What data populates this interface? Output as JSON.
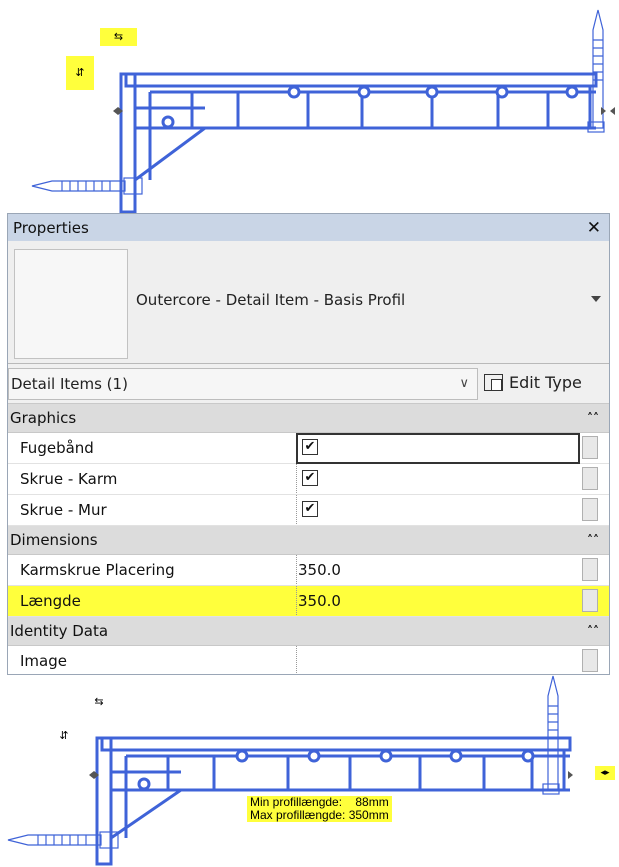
{
  "top_view": {
    "flip_h_icon": "⇆",
    "flip_v_icon": "⇵"
  },
  "properties": {
    "title": "Properties",
    "close_icon": "✕",
    "type_name": "Outercore - Detail Item - Basis Profil",
    "selector_label": "Detail Items (1)",
    "edit_type_label": "Edit Type",
    "groups": [
      {
        "label": "Graphics"
      },
      {
        "label": "Dimensions"
      },
      {
        "label": "Identity Data"
      }
    ],
    "graphics_rows": [
      {
        "name": "Fugebånd",
        "checked": true
      },
      {
        "name": "Skrue - Karm",
        "checked": true
      },
      {
        "name": "Skrue - Mur",
        "checked": true
      }
    ],
    "dimension_rows": [
      {
        "name": "Karmskrue Placering",
        "value": "350.0"
      },
      {
        "name": "Længde",
        "value": "350.0"
      }
    ],
    "identity_rows": [
      {
        "name": "Image",
        "value": ""
      }
    ],
    "check_mark": "✔",
    "highlight_color": "#ffff3c",
    "profile_color": "#3f63d8"
  },
  "bottom_view": {
    "flip_h_icon": "⇆",
    "flip_v_icon": "⇵",
    "stretch_icon": "◂▸",
    "tooltip_line1": "Min profillængde:    88mm",
    "tooltip_line2": "Max profillængde: 350mm"
  }
}
